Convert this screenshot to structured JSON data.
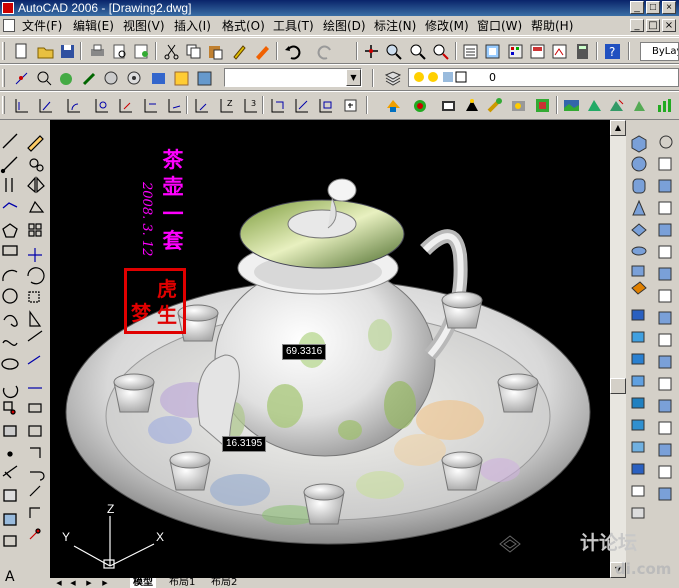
{
  "window": {
    "title": "AutoCAD 2006 - [Drawing2.dwg]",
    "min_label": "_",
    "restore_label": "□",
    "close_label": "×",
    "doc_min_label": "_",
    "doc_restore_label": "□",
    "doc_close_label": "×"
  },
  "menubar": {
    "items": [
      {
        "label": "文件(F)"
      },
      {
        "label": "编辑(E)"
      },
      {
        "label": "视图(V)"
      },
      {
        "label": "插入(I)"
      },
      {
        "label": "格式(O)"
      },
      {
        "label": "工具(T)"
      },
      {
        "label": "绘图(D)"
      },
      {
        "label": "标注(N)"
      },
      {
        "label": "修改(M)"
      },
      {
        "label": "窗口(W)"
      },
      {
        "label": "帮助(H)"
      }
    ]
  },
  "toolbars": {
    "layer_combo_value": "",
    "layer_state_value": "0",
    "bylayer_value": "ByLayer",
    "combo_arrow": "▼"
  },
  "drawing": {
    "title_vertical": "茶壶一套",
    "signature": "2008. 3. 12",
    "seal_chars": [
      "虎",
      "生",
      "梦"
    ],
    "dimension_1": "69.3316",
    "dimension_2": "16.3195",
    "axis_x": "X",
    "axis_y": "Y",
    "axis_z": "Z",
    "watermark_1": "计论坛",
    "watermark_2": "di.com"
  },
  "tabs": {
    "items": [
      {
        "label": "模型"
      },
      {
        "label": "布局1"
      },
      {
        "label": "布局2"
      }
    ],
    "nav_first": "◀",
    "nav_prev": "◀",
    "nav_next": "▶",
    "nav_last": "▶"
  },
  "scroll": {
    "up": "▲",
    "down": "▼"
  },
  "colors": {
    "canvas": "#000000",
    "title_text": "#ff00ff",
    "seal": "#e00000",
    "teapot": "#d8d8d8"
  }
}
